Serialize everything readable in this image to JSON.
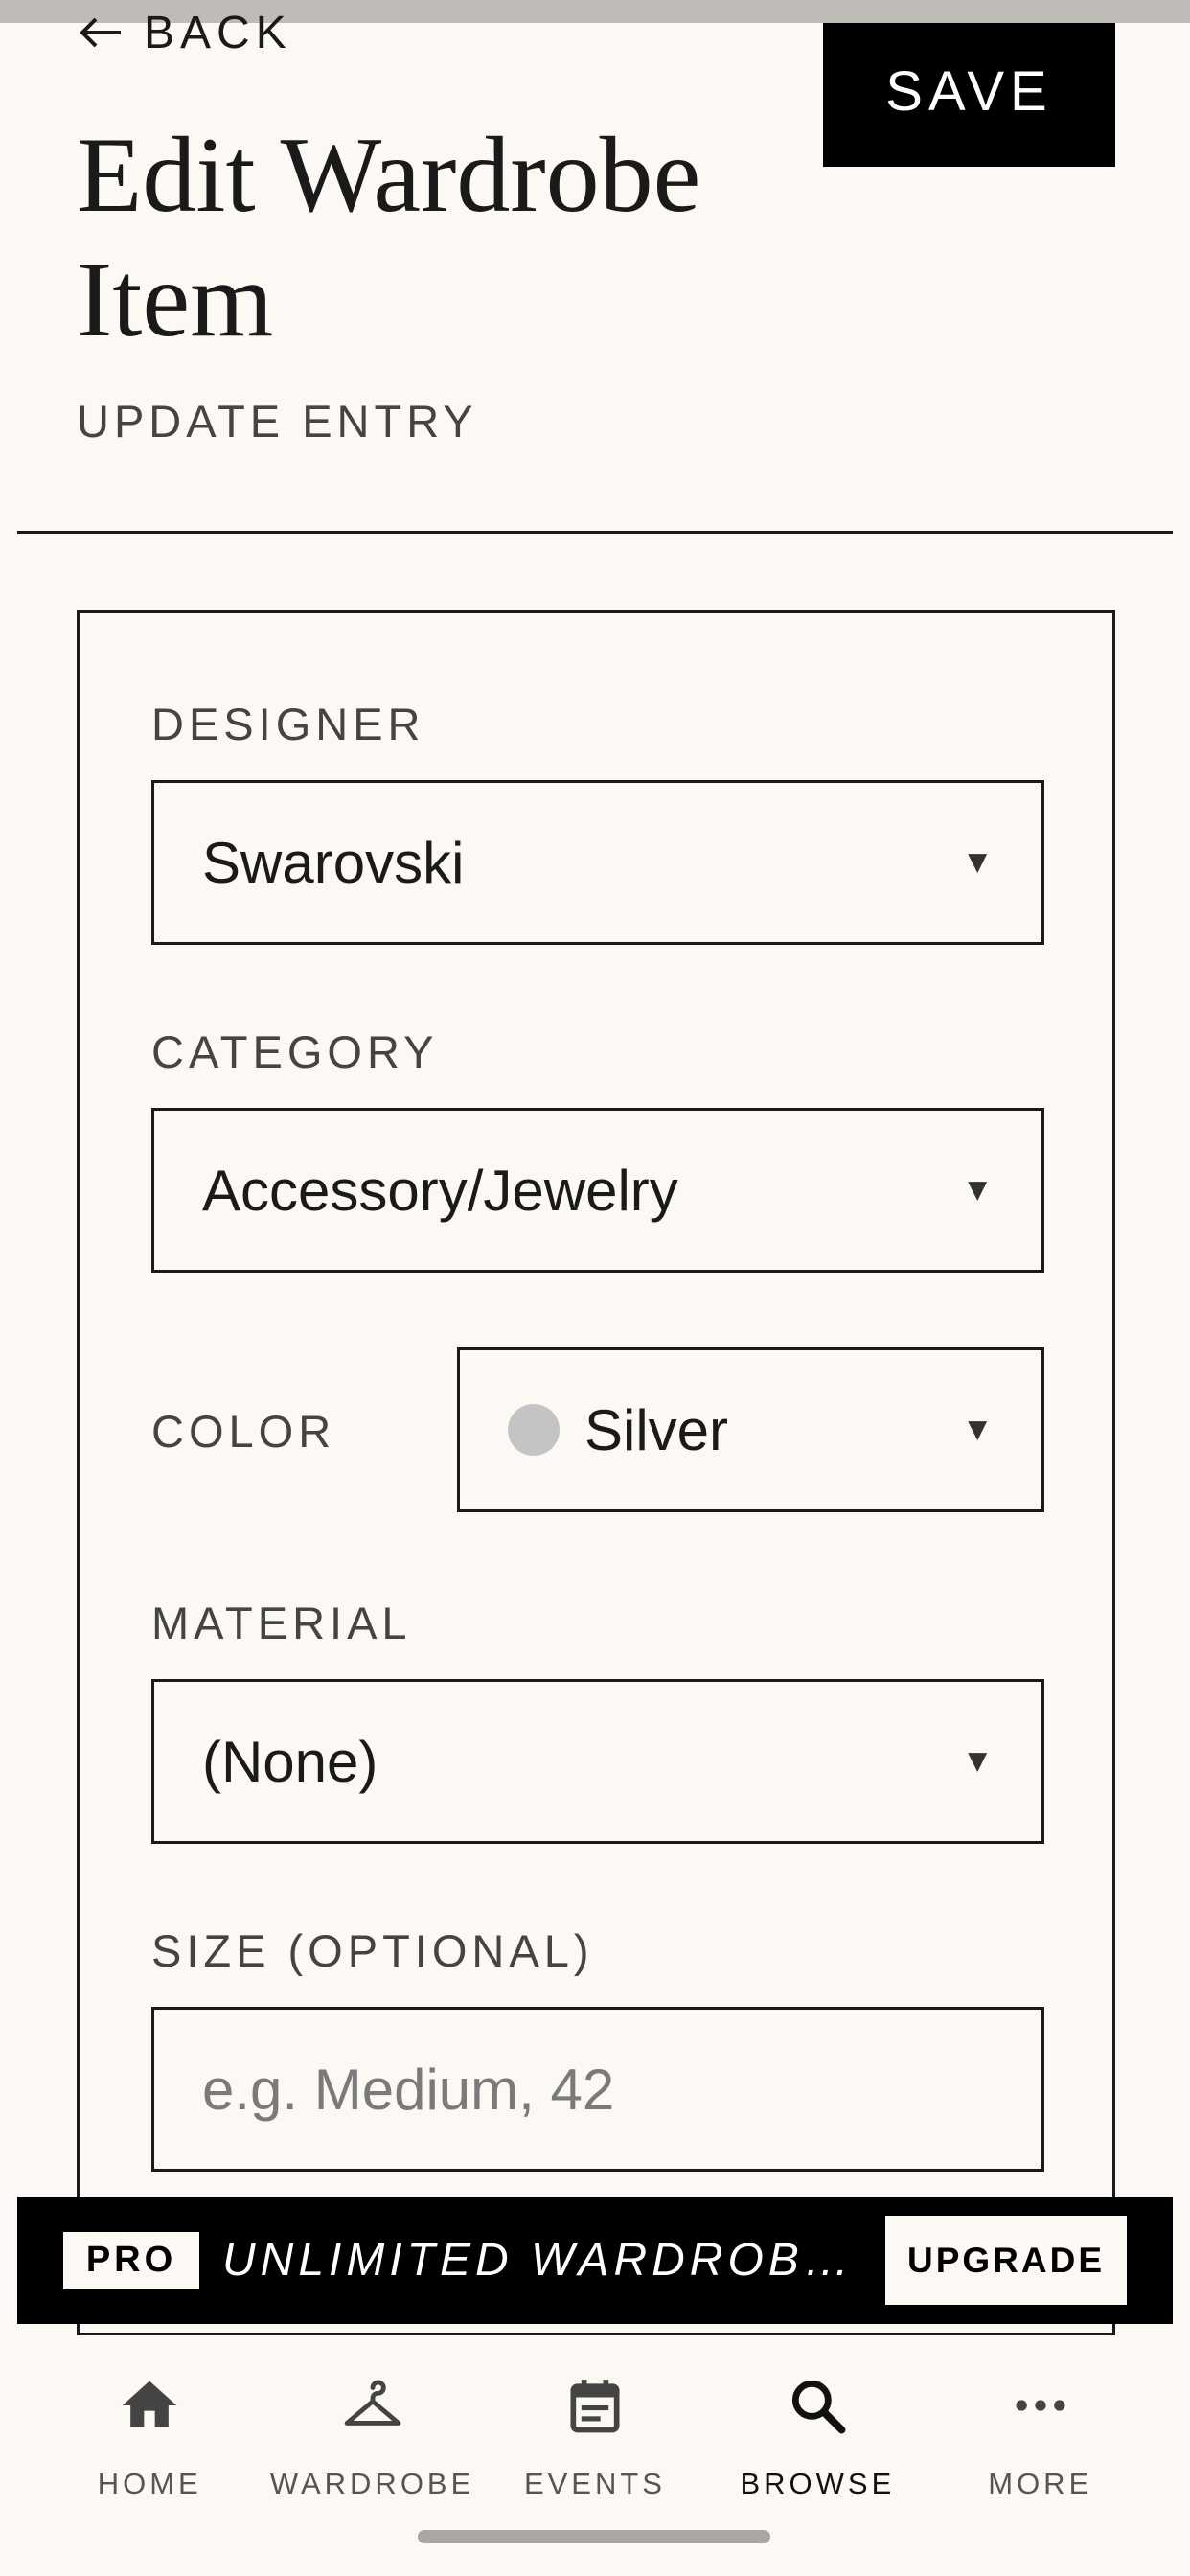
{
  "header": {
    "back_label": "BACK",
    "save_label": "SAVE",
    "title": "Edit Wardrobe Item",
    "subtitle": "UPDATE ENTRY"
  },
  "form": {
    "designer": {
      "label": "DESIGNER",
      "value": "Swarovski"
    },
    "category": {
      "label": "CATEGORY",
      "value": "Accessory/Jewelry"
    },
    "color": {
      "label": "COLOR",
      "value": "Silver",
      "swatch": "#c4c4c4"
    },
    "material": {
      "label": "MATERIAL",
      "value": "(None)"
    },
    "size": {
      "label": "SIZE (OPTIONAL)",
      "value": "",
      "placeholder": "e.g. Medium, 42"
    },
    "caret_glyph": "▼"
  },
  "promo": {
    "badge": "PRO",
    "text": "UNLIMITED WARDROBE. N…",
    "upgrade_label": "UPGRADE"
  },
  "nav": {
    "items": [
      {
        "label": "HOME",
        "icon": "home-icon"
      },
      {
        "label": "WARDROBE",
        "icon": "hanger-icon"
      },
      {
        "label": "EVENTS",
        "icon": "calendar-icon"
      },
      {
        "label": "BROWSE",
        "icon": "search-icon",
        "active": true
      },
      {
        "label": "MORE",
        "icon": "more-icon"
      }
    ]
  },
  "colors": {
    "background": "#fcf8f3",
    "ink": "#1a1a1a",
    "accent": "#000000"
  }
}
